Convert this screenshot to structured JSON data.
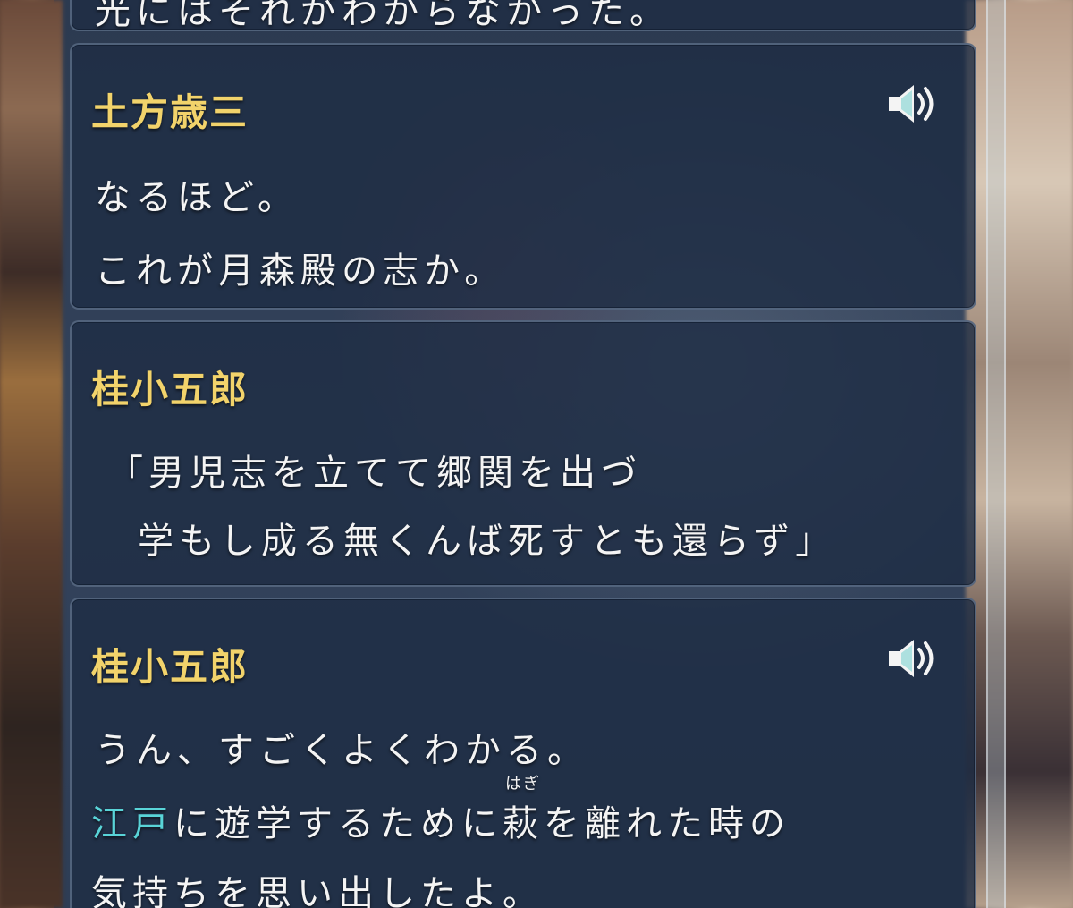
{
  "log": {
    "top_partial_text": "光にはそれがわからなかった。",
    "entries": [
      {
        "speaker": "土方歳三",
        "has_voice": true,
        "lines": [
          "なるほど。",
          "これが月森殿の志か。"
        ]
      },
      {
        "speaker": "桂小五郎",
        "has_voice": false,
        "lines": [
          "「男児志を立てて郷関を出づ",
          "学もし成る無くんば死すとも還らず」"
        ]
      },
      {
        "speaker": "桂小五郎",
        "has_voice": true,
        "line1": "うん、すごくよくわかる。",
        "line2": {
          "highlight": "江戸",
          "part_a": "に遊学するために",
          "ruby_base": "萩",
          "ruby_reading": "はぎ",
          "part_b": "を離れた時の"
        },
        "line3": "気持ちを思い出したよ。"
      }
    ]
  },
  "icons": {
    "voice": "speaker-volume-icon"
  },
  "colors": {
    "speaker_name": "#f2d36b",
    "dialogue_text": "#f4f4f4",
    "highlight_term": "#59d4d8",
    "card_background": "#1e2d44"
  }
}
